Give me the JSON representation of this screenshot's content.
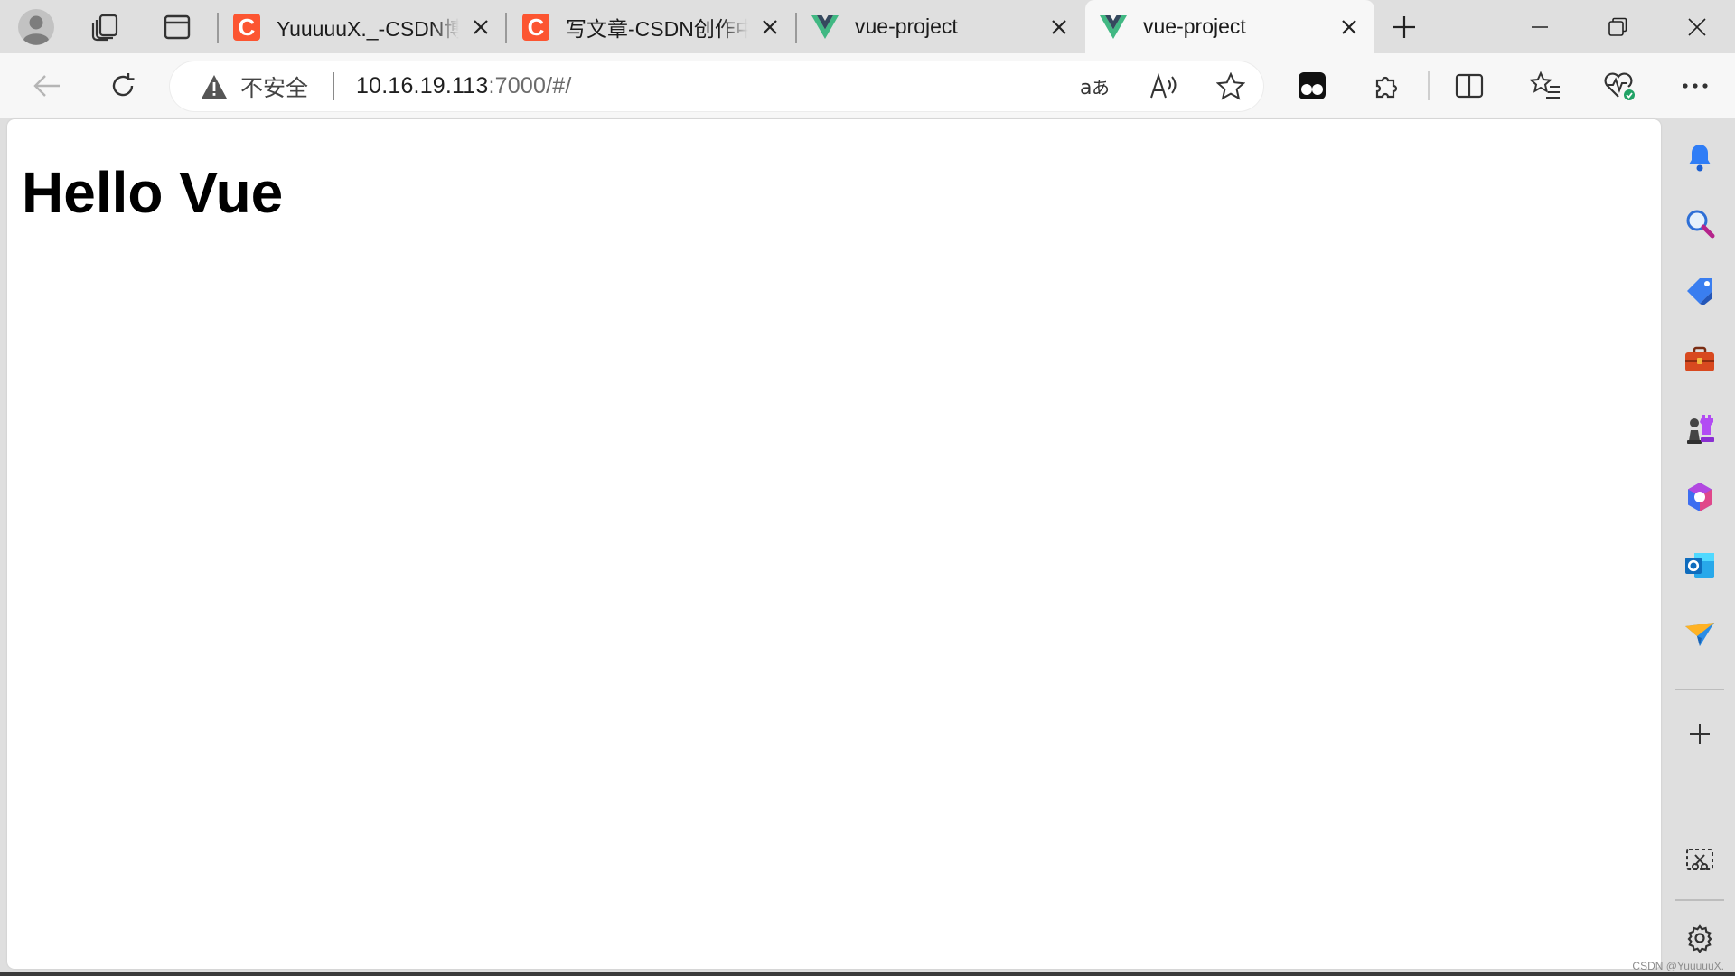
{
  "browser": {
    "tabs": [
      {
        "title": "YuuuuuX._-CSDN博客",
        "favicon": "csdn-icon",
        "favicon_letter": "C",
        "active": false
      },
      {
        "title": "写文章-CSDN创作中心",
        "favicon": "csdn-icon",
        "favicon_letter": "C",
        "active": false
      },
      {
        "title": "vue-project",
        "favicon": "vue-icon",
        "active": false
      },
      {
        "title": "vue-project",
        "favicon": "vue-icon",
        "active": true
      }
    ],
    "address_bar": {
      "security_label": "不安全",
      "url_host": "10.16.19.113",
      "url_rest": ":7000/#/"
    }
  },
  "page": {
    "heading": "Hello Vue"
  },
  "sidebar": {
    "items": [
      "bell-icon",
      "search-icon",
      "shopping-tag-icon",
      "tools-briefcase-icon",
      "games-icon",
      "microsoft-365-icon",
      "outlook-icon",
      "send-icon"
    ]
  },
  "watermark": "CSDN @YuuuuuX.",
  "colors": {
    "chrome_background": "#dfdfdf",
    "toolbar_background": "#f7f7f7",
    "csdn_brand": "#fc5531",
    "vue_green": "#41b883",
    "vue_dark": "#35495e"
  }
}
